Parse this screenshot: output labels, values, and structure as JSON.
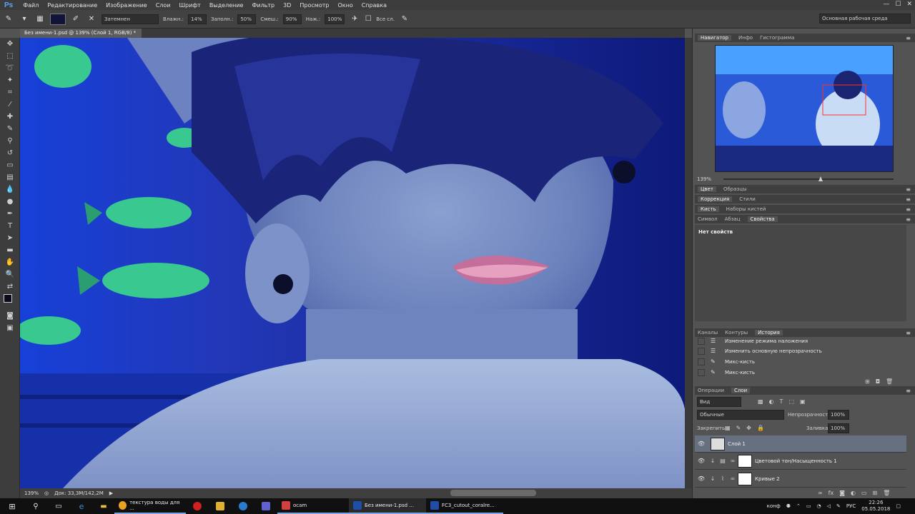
{
  "app": {
    "logo": "Ps",
    "menu": [
      "Файл",
      "Редактирование",
      "Изображение",
      "Слои",
      "Шрифт",
      "Выделение",
      "Фильтр",
      "3D",
      "Просмотр",
      "Окно",
      "Справка"
    ],
    "window_controls": [
      "—",
      "☐",
      "✕"
    ]
  },
  "options": {
    "blend_mode": "Затемнен",
    "opacity_label": "Влажн.:",
    "opacity_value": "14%",
    "load_label": "Заполн.:",
    "load_value": "50%",
    "mix_label": "Смеш.:",
    "mix_value": "90%",
    "flow_label": "Наж.:",
    "flow_value": "100%",
    "all_layers_label": "Все сл.",
    "workspace": "Основная рабочая среда",
    "fg_color": "#101438"
  },
  "document": {
    "tab_title": "Без имени-1.psd @ 139% (Слой 1, RGB/8) *",
    "zoom": "139%",
    "doc_info": "Док: 33,3М/142,2М"
  },
  "navigator": {
    "tabs": [
      "Навигатор",
      "Инфо",
      "Гистограмма"
    ],
    "zoom": "139%"
  },
  "panels": {
    "color_tabs": [
      "Цвет",
      "Образцы"
    ],
    "adjust_tabs": [
      "Коррекция",
      "Стили"
    ],
    "brush_tabs": [
      "Кисть",
      "Наборы кистей"
    ],
    "props_tabs": [
      "Символ",
      "Абзац",
      "Свойства"
    ],
    "no_props": "Нет свойств",
    "history_tabs": [
      "Каналы",
      "Контуры",
      "История"
    ],
    "history_items": [
      {
        "label": "Изменение режима наложения",
        "icon": "☰"
      },
      {
        "label": "Изменить основную непрозрачность",
        "icon": "☰"
      },
      {
        "label": "Микс-кисть",
        "icon": "✎"
      },
      {
        "label": "Микс-кисть",
        "icon": "✎"
      }
    ],
    "layers_tabs": [
      "Операции",
      "Слои"
    ],
    "layer_filter": "Вид",
    "layer_blend": "Обычные",
    "layer_opacity_label": "Непрозрачность:",
    "layer_opacity": "100%",
    "lock_label": "Закрепить:",
    "fill_label": "Заливка:",
    "fill_value": "100%",
    "layers": [
      {
        "name": "Слой 1",
        "selected": true
      },
      {
        "name": "Цветовой тон/Насыщенность 1",
        "selected": false
      },
      {
        "name": "Кривые 2",
        "selected": false
      }
    ]
  },
  "taskbar": {
    "items": [
      {
        "label": "текстура воды для ...",
        "color": "#e8a320"
      },
      {
        "label": "",
        "color": "#d02020"
      },
      {
        "label": "",
        "color": "#e0b030"
      },
      {
        "label": "",
        "color": "#2a7ad0"
      },
      {
        "label": "",
        "color": "#6060d0"
      },
      {
        "label": "ocam",
        "color": "#d04040"
      },
      {
        "label": "Без имени-1.psd ...",
        "color": "#1e4ea8"
      },
      {
        "label": "FC3_cutout_coralre...",
        "color": "#1e4ea8"
      }
    ],
    "weather": "конф",
    "lang": "РУС",
    "time": "22:26",
    "date": "05.05.2018"
  }
}
